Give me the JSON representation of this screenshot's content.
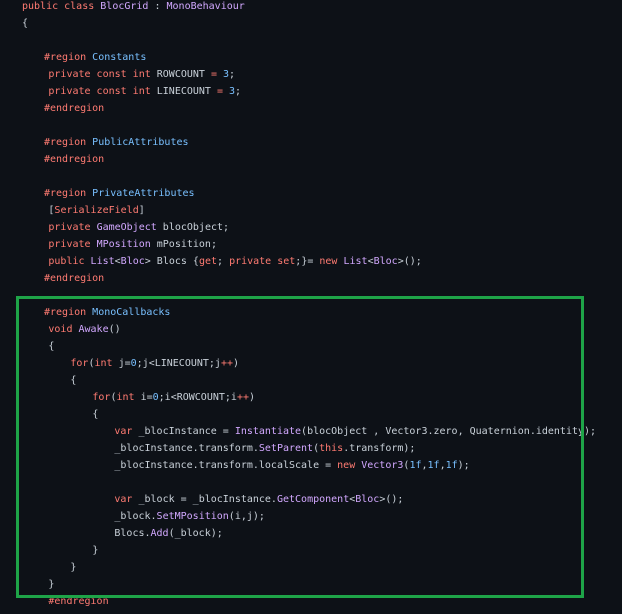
{
  "colors": {
    "background": "#0d1117",
    "highlight_border": "#1ea448",
    "keyword": "#ff7b72",
    "type": "#d2a8ff",
    "default": "#c9d1d9",
    "region": "#79c0ff"
  },
  "code_lines": [
    {
      "indent": 0,
      "tokens": [
        {
          "t": "public class ",
          "k": "keyword"
        },
        {
          "t": "BlocGrid",
          "k": "type"
        },
        {
          "t": " : ",
          "k": "default"
        },
        {
          "t": "MonoBehaviour",
          "k": "type"
        }
      ]
    },
    {
      "indent": 0,
      "tokens": [
        {
          "t": "{",
          "k": "default"
        }
      ]
    },
    {
      "indent": 0,
      "tokens": []
    },
    {
      "indent": 1,
      "tokens": [
        {
          "t": "#region ",
          "k": "keyword"
        },
        {
          "t": "Constants",
          "k": "region"
        }
      ]
    },
    {
      "indent": 1.2,
      "tokens": [
        {
          "t": "private const int ",
          "k": "keyword"
        },
        {
          "t": "ROWCOUNT",
          "k": "default"
        },
        {
          "t": " = ",
          "k": "keyword"
        },
        {
          "t": "3",
          "k": "region"
        },
        {
          "t": ";",
          "k": "default"
        }
      ]
    },
    {
      "indent": 1.2,
      "tokens": [
        {
          "t": "private const int ",
          "k": "keyword"
        },
        {
          "t": "LINECOUNT",
          "k": "default"
        },
        {
          "t": " = ",
          "k": "keyword"
        },
        {
          "t": "3",
          "k": "region"
        },
        {
          "t": ";",
          "k": "default"
        }
      ]
    },
    {
      "indent": 1,
      "tokens": [
        {
          "t": "#endregion",
          "k": "keyword"
        }
      ]
    },
    {
      "indent": 0,
      "tokens": []
    },
    {
      "indent": 1,
      "tokens": [
        {
          "t": "#region ",
          "k": "keyword"
        },
        {
          "t": "PublicAttributes",
          "k": "region"
        }
      ]
    },
    {
      "indent": 1,
      "tokens": [
        {
          "t": "#endregion",
          "k": "keyword"
        }
      ]
    },
    {
      "indent": 0,
      "tokens": []
    },
    {
      "indent": 1,
      "tokens": [
        {
          "t": "#region ",
          "k": "keyword"
        },
        {
          "t": "PrivateAttributes",
          "k": "region"
        }
      ]
    },
    {
      "indent": 1.2,
      "tokens": [
        {
          "t": "[",
          "k": "default"
        },
        {
          "t": "SerializeField",
          "k": "keyword"
        },
        {
          "t": "]",
          "k": "default"
        }
      ]
    },
    {
      "indent": 1.2,
      "tokens": [
        {
          "t": "private ",
          "k": "keyword"
        },
        {
          "t": "GameObject",
          "k": "type"
        },
        {
          "t": " blocObject;",
          "k": "default"
        }
      ]
    },
    {
      "indent": 1.2,
      "tokens": [
        {
          "t": "private ",
          "k": "keyword"
        },
        {
          "t": "MPosition",
          "k": "type"
        },
        {
          "t": " mPosition;",
          "k": "default"
        }
      ]
    },
    {
      "indent": 1.2,
      "tokens": [
        {
          "t": "public ",
          "k": "keyword"
        },
        {
          "t": "List",
          "k": "type"
        },
        {
          "t": "<",
          "k": "default"
        },
        {
          "t": "Bloc",
          "k": "type"
        },
        {
          "t": "> Blocs {",
          "k": "default"
        },
        {
          "t": "get",
          "k": "keyword"
        },
        {
          "t": "; ",
          "k": "default"
        },
        {
          "t": "private set",
          "k": "keyword"
        },
        {
          "t": ";}= ",
          "k": "default"
        },
        {
          "t": "new ",
          "k": "keyword"
        },
        {
          "t": "List",
          "k": "type"
        },
        {
          "t": "<",
          "k": "default"
        },
        {
          "t": "Bloc",
          "k": "type"
        },
        {
          "t": ">();",
          "k": "default"
        }
      ]
    },
    {
      "indent": 1,
      "tokens": [
        {
          "t": "#endregion",
          "k": "keyword"
        }
      ]
    },
    {
      "indent": 0,
      "tokens": []
    },
    {
      "indent": 1,
      "tokens": [
        {
          "t": "#region ",
          "k": "keyword"
        },
        {
          "t": "MonoCallbacks",
          "k": "region"
        }
      ]
    },
    {
      "indent": 1.2,
      "tokens": [
        {
          "t": "void ",
          "k": "keyword"
        },
        {
          "t": "Awake",
          "k": "type"
        },
        {
          "t": "()",
          "k": "default"
        }
      ]
    },
    {
      "indent": 1.2,
      "tokens": [
        {
          "t": "{",
          "k": "default"
        }
      ]
    },
    {
      "indent": 2.2,
      "tokens": [
        {
          "t": "for",
          "k": "keyword"
        },
        {
          "t": "(",
          "k": "default"
        },
        {
          "t": "int ",
          "k": "keyword"
        },
        {
          "t": "j=",
          "k": "default"
        },
        {
          "t": "0",
          "k": "region"
        },
        {
          "t": ";j<LINECOUNT;j",
          "k": "default"
        },
        {
          "t": "++",
          "k": "keyword"
        },
        {
          "t": ")",
          "k": "default"
        }
      ]
    },
    {
      "indent": 2.2,
      "tokens": [
        {
          "t": "{",
          "k": "default"
        }
      ]
    },
    {
      "indent": 3.2,
      "tokens": [
        {
          "t": "for",
          "k": "keyword"
        },
        {
          "t": "(",
          "k": "default"
        },
        {
          "t": "int ",
          "k": "keyword"
        },
        {
          "t": "i=",
          "k": "default"
        },
        {
          "t": "0",
          "k": "region"
        },
        {
          "t": ";i<ROWCOUNT;i",
          "k": "default"
        },
        {
          "t": "++",
          "k": "keyword"
        },
        {
          "t": ")",
          "k": "default"
        }
      ]
    },
    {
      "indent": 3.2,
      "tokens": [
        {
          "t": "{",
          "k": "default"
        }
      ]
    },
    {
      "indent": 4.2,
      "tokens": [
        {
          "t": "var ",
          "k": "keyword"
        },
        {
          "t": "_blocInstance = ",
          "k": "default"
        },
        {
          "t": "Instantiate",
          "k": "type"
        },
        {
          "t": "(blocObject , Vector3.zero, Quaternion.identity);",
          "k": "default"
        }
      ]
    },
    {
      "indent": 4.2,
      "tokens": [
        {
          "t": "_blocInstance.transform.",
          "k": "default"
        },
        {
          "t": "SetParent",
          "k": "type"
        },
        {
          "t": "(",
          "k": "default"
        },
        {
          "t": "this",
          "k": "keyword"
        },
        {
          "t": ".transform);",
          "k": "default"
        }
      ]
    },
    {
      "indent": 4.2,
      "tokens": [
        {
          "t": "_blocInstance.transform.localScale = ",
          "k": "default"
        },
        {
          "t": "new ",
          "k": "keyword"
        },
        {
          "t": "Vector3",
          "k": "type"
        },
        {
          "t": "(",
          "k": "default"
        },
        {
          "t": "1f",
          "k": "region"
        },
        {
          "t": ",",
          "k": "default"
        },
        {
          "t": "1f",
          "k": "region"
        },
        {
          "t": ",",
          "k": "default"
        },
        {
          "t": "1f",
          "k": "region"
        },
        {
          "t": ");",
          "k": "default"
        }
      ]
    },
    {
      "indent": 0,
      "tokens": []
    },
    {
      "indent": 4.2,
      "tokens": [
        {
          "t": "var ",
          "k": "keyword"
        },
        {
          "t": "_block = _blocInstance.",
          "k": "default"
        },
        {
          "t": "GetComponent",
          "k": "type"
        },
        {
          "t": "<",
          "k": "default"
        },
        {
          "t": "Bloc",
          "k": "type"
        },
        {
          "t": ">();",
          "k": "default"
        }
      ]
    },
    {
      "indent": 4.2,
      "tokens": [
        {
          "t": "_block.",
          "k": "default"
        },
        {
          "t": "SetMPosition",
          "k": "type"
        },
        {
          "t": "(i,j);",
          "k": "default"
        }
      ]
    },
    {
      "indent": 4.2,
      "tokens": [
        {
          "t": "Blocs.",
          "k": "default"
        },
        {
          "t": "Add",
          "k": "type"
        },
        {
          "t": "(_block);",
          "k": "default"
        }
      ]
    },
    {
      "indent": 3.2,
      "tokens": [
        {
          "t": "}",
          "k": "default"
        }
      ]
    },
    {
      "indent": 2.2,
      "tokens": [
        {
          "t": "}",
          "k": "default"
        }
      ]
    },
    {
      "indent": 1.2,
      "tokens": [
        {
          "t": "}",
          "k": "default"
        }
      ]
    },
    {
      "indent": 1.2,
      "tokens": [
        {
          "t": "#endregion",
          "k": "keyword"
        }
      ]
    }
  ]
}
